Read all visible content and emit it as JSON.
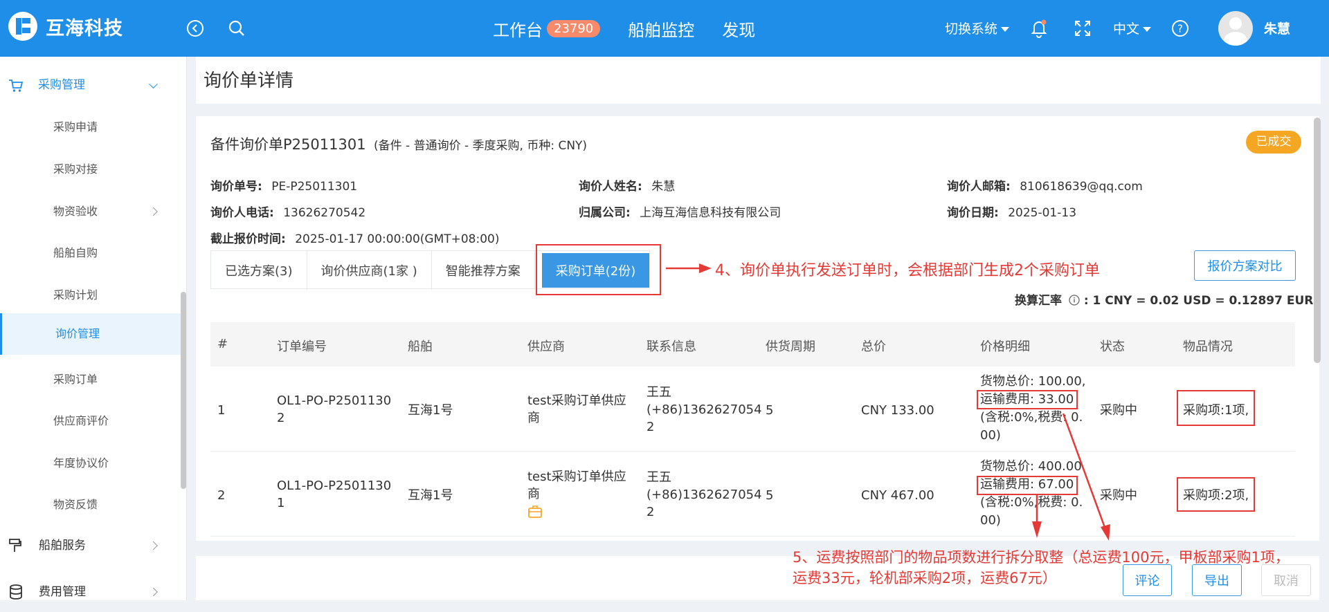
{
  "header": {
    "brand": "互海科技",
    "nav": [
      {
        "label": "工作台",
        "badge": "23790"
      },
      {
        "label": "船舶监控"
      },
      {
        "label": "发现"
      }
    ],
    "switch_system": "切换系统",
    "language": "中文",
    "user_name": "朱慧",
    "colors": {
      "primary": "#1e8ee8",
      "badge": "#f78a6b",
      "accent": "#e53935"
    }
  },
  "sidebar": {
    "group_purchase": "采购管理",
    "items": [
      {
        "label": "采购申请"
      },
      {
        "label": "采购对接"
      },
      {
        "label": "物资验收"
      },
      {
        "label": "船舶自购"
      },
      {
        "label": "采购计划"
      },
      {
        "label": "询价管理"
      },
      {
        "label": "采购订单"
      },
      {
        "label": "供应商评价"
      },
      {
        "label": "年度协议价"
      },
      {
        "label": "物资反馈"
      }
    ],
    "group_ship_service": "船舶服务",
    "group_cost": "费用管理"
  },
  "page": {
    "title": "询价单详情",
    "doc_title": "备件询价单P25011301",
    "doc_subtitle": "(备件 - 普通询价 - 季度采购, 币种: CNY)",
    "status": "已成交",
    "info": {
      "order_no_label": "询价单号:",
      "order_no": "PE-P25011301",
      "inquirer_name_label": "询价人姓名:",
      "inquirer_name": "朱慧",
      "inquirer_email_label": "询价人邮箱:",
      "inquirer_email": "810618639@qq.com",
      "inquirer_phone_label": "询价人电话:",
      "inquirer_phone": "13626270542",
      "company_label": "归属公司:",
      "company": "上海互海信息科技有限公司",
      "inquiry_date_label": "询价日期:",
      "inquiry_date": "2025-01-13",
      "deadline_label": "截止报价时间:",
      "deadline": "2025-01-17 00:00:00(GMT+08:00)"
    },
    "tabs": [
      {
        "label": "已选方案(3)"
      },
      {
        "label": "询价供应商(1家 )"
      },
      {
        "label": "智能推荐方案"
      },
      {
        "label": "采购订单(2份)"
      }
    ],
    "compare_button": "报价方案对比",
    "rate_label": "换算汇率",
    "rate_value": ":  1 CNY = 0.02 USD = 0.12897 EUR",
    "annotation_1": "4、询价单执行发送订单时，会根据部门生成2个采购订单",
    "annotation_2_line1": "5、运费按照部门的物品项数进行拆分取整（总运费100元，甲板部采购1项，",
    "annotation_2_line2": "运费33元，轮机部采购2项，运费67元）",
    "table": {
      "headers": [
        "#",
        "订单编号",
        "船舶",
        "供应商",
        "联系信息",
        "供货周期",
        "总价",
        "价格明细",
        "状态",
        "物品情况"
      ],
      "rows": [
        {
          "idx": "1",
          "order_no_l1": "OL1-PO-P2501130",
          "order_no_l2": "2",
          "ship": "互海1号",
          "supplier_l1": "test采购订单供应",
          "supplier_l2": "商",
          "contact_l1": "王五",
          "contact_l2": "(+86)1362627054",
          "contact_l3": "2",
          "cycle": "5",
          "total": "CNY 133.00",
          "price_l1": "货物总价: 100.00,",
          "price_l2": "运输费用: 33.00",
          "price_l3": "(含税:0%,税费: 0.",
          "price_l4": "00)",
          "status": "采购中",
          "items": "采购项:1项,"
        },
        {
          "idx": "2",
          "order_no_l1": "OL1-PO-P2501130",
          "order_no_l2": "1",
          "ship": "互海1号",
          "supplier_l1": "test采购订单供应",
          "supplier_l2": "商",
          "contact_l1": "王五",
          "contact_l2": "(+86)1362627054",
          "contact_l3": "2",
          "cycle": "5",
          "total": "CNY 467.00",
          "price_l1": "货物总价: 400.00",
          "price_l2": "运输费用: 67.00",
          "price_l3": "(含税:0%,税费: 0.",
          "price_l4": "00)",
          "status": "采购中",
          "items": "采购项:2项,"
        }
      ]
    },
    "footer_buttons": {
      "comment": "评论",
      "export": "导出",
      "cancel": "取消"
    }
  }
}
